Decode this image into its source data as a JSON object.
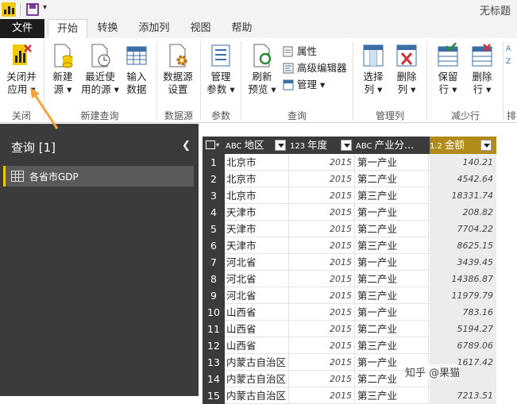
{
  "window": {
    "title": "无标题"
  },
  "tabs": [
    {
      "label": "文件"
    },
    {
      "label": "开始"
    },
    {
      "label": "转换"
    },
    {
      "label": "添加列"
    },
    {
      "label": "视图"
    },
    {
      "label": "帮助"
    }
  ],
  "ribbon": {
    "close_apply": {
      "line1": "关闭并",
      "line2": "应用"
    },
    "new_source": {
      "line1": "新建",
      "line2": "源"
    },
    "recent_sources": {
      "line1": "最近使",
      "line2": "用的源"
    },
    "enter_data": {
      "line1": "输入",
      "line2": "数据"
    },
    "datasource_settings": {
      "line1": "数据源",
      "line2": "设置"
    },
    "manage_params": {
      "line1": "管理",
      "line2": "参数"
    },
    "refresh_preview": {
      "line1": "刷新",
      "line2": "预览"
    },
    "properties": "属性",
    "advanced_editor": "高级编辑器",
    "manage": "管理",
    "choose_columns": {
      "line1": "选择",
      "line2": "列"
    },
    "remove_columns": {
      "line1": "删除",
      "line2": "列"
    },
    "keep_rows": {
      "line1": "保留",
      "line2": "行"
    },
    "remove_rows": {
      "line1": "删除",
      "line2": "行"
    },
    "sort_partial": "排",
    "groups": {
      "close": "关闭",
      "new_query": "新建查询",
      "datasource": "数据源",
      "params": "参数",
      "query": "查询",
      "manage_cols": "管理列",
      "reduce_rows": "减少行"
    }
  },
  "queries_panel": {
    "title": "查询 [1]",
    "items": [
      {
        "label": "各省市GDP"
      }
    ]
  },
  "grid": {
    "columns": [
      {
        "type": "ABC",
        "name": "地区"
      },
      {
        "type": "123",
        "name": "年度"
      },
      {
        "type": "ABC",
        "name": "产业分..."
      },
      {
        "type": "1.2",
        "name": "金额"
      }
    ],
    "rows": [
      {
        "n": "1",
        "region": "北京市",
        "year": "2015",
        "industry": "第一产业",
        "amount": "140.21"
      },
      {
        "n": "2",
        "region": "北京市",
        "year": "2015",
        "industry": "第二产业",
        "amount": "4542.64"
      },
      {
        "n": "3",
        "region": "北京市",
        "year": "2015",
        "industry": "第三产业",
        "amount": "18331.74"
      },
      {
        "n": "4",
        "region": "天津市",
        "year": "2015",
        "industry": "第一产业",
        "amount": "208.82"
      },
      {
        "n": "5",
        "region": "天津市",
        "year": "2015",
        "industry": "第二产业",
        "amount": "7704.22"
      },
      {
        "n": "6",
        "region": "天津市",
        "year": "2015",
        "industry": "第三产业",
        "amount": "8625.15"
      },
      {
        "n": "7",
        "region": "河北省",
        "year": "2015",
        "industry": "第一产业",
        "amount": "3439.45"
      },
      {
        "n": "8",
        "region": "河北省",
        "year": "2015",
        "industry": "第二产业",
        "amount": "14386.87"
      },
      {
        "n": "9",
        "region": "河北省",
        "year": "2015",
        "industry": "第三产业",
        "amount": "11979.79"
      },
      {
        "n": "10",
        "region": "山西省",
        "year": "2015",
        "industry": "第一产业",
        "amount": "783.16"
      },
      {
        "n": "11",
        "region": "山西省",
        "year": "2015",
        "industry": "第二产业",
        "amount": "5194.27"
      },
      {
        "n": "12",
        "region": "山西省",
        "year": "2015",
        "industry": "第三产业",
        "amount": "6789.06"
      },
      {
        "n": "13",
        "region": "内蒙古自治区",
        "year": "2015",
        "industry": "第一产业",
        "amount": "1617.42"
      },
      {
        "n": "14",
        "region": "内蒙古自治区",
        "year": "2015",
        "industry": "第二产业",
        "amount": ""
      },
      {
        "n": "15",
        "region": "内蒙古自治区",
        "year": "2015",
        "industry": "第三产业",
        "amount": "7213.51"
      }
    ]
  },
  "watermark": "知乎 @果猫",
  "colors": {
    "accent": "#f2c811",
    "dark_panel": "#3b3b3b",
    "selected_header": "#b08b1a"
  }
}
